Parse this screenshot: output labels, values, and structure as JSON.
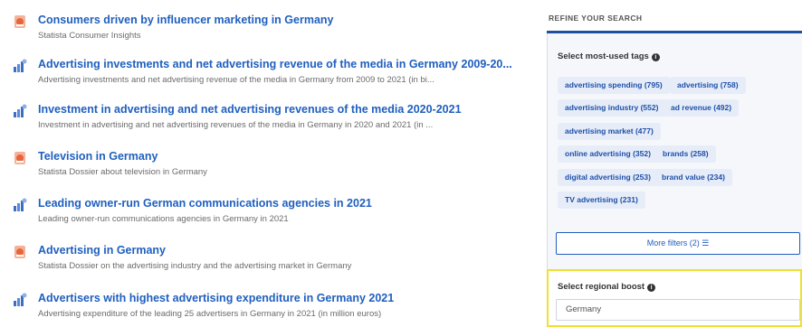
{
  "results": [
    {
      "icon": "dossier-icon",
      "title": "Consumers driven by influencer marketing in Germany",
      "desc": "Statista Consumer Insights"
    },
    {
      "icon": "statistic-icon",
      "title": "Advertising investments and net advertising revenue of the media in Germany 2009-20...",
      "desc": "Advertising investments and net advertising revenue of the media in Germany from 2009 to 2021 (in bi..."
    },
    {
      "icon": "statistic-icon",
      "title": "Investment in advertising and net advertising revenues of the media 2020-2021",
      "desc": "Investment in advertising and net advertising revenues of the media in Germany in 2020 and 2021 (in ..."
    },
    {
      "icon": "dossier-icon",
      "title": "Television in Germany",
      "desc": "Statista Dossier about television in Germany"
    },
    {
      "icon": "statistic-icon",
      "title": "Leading owner-run German communications agencies in 2021",
      "desc": "Leading owner-run communications agencies in Germany in 2021"
    },
    {
      "icon": "dossier-icon",
      "title": "Advertising in Germany",
      "desc": "Statista Dossier on the advertising industry and the advertising market in Germany"
    },
    {
      "icon": "statistic-icon",
      "title": "Advertisers with highest advertising expenditure in Germany 2021",
      "desc": "Advertising expenditure of the leading 25 advertisers in Germany in 2021 (in million euros)"
    }
  ],
  "sidebar": {
    "refine_label": "REFINE YOUR SEARCH",
    "tags_label": "Select most-used tags",
    "tags": [
      "advertising spending (795)",
      "advertising (758)",
      "advertising industry (552)",
      "ad revenue (492)",
      "advertising market (477)",
      "online advertising (352)",
      "brands (258)",
      "digital advertising (253)",
      "brand value (234)",
      "TV advertising (231)"
    ],
    "more_filters_label": "More filters (2) ☰",
    "region_label": "Select regional boost",
    "region_value": "Germany",
    "info_glyph": "i"
  },
  "colors": {
    "link": "#1f5fbf",
    "accent_line": "#1e4fa0",
    "tag_bg": "#e6edf9",
    "highlight": "#f0e033",
    "dossier_icon": "#f07a4a",
    "statistic_icon": "#3a6fc4"
  }
}
